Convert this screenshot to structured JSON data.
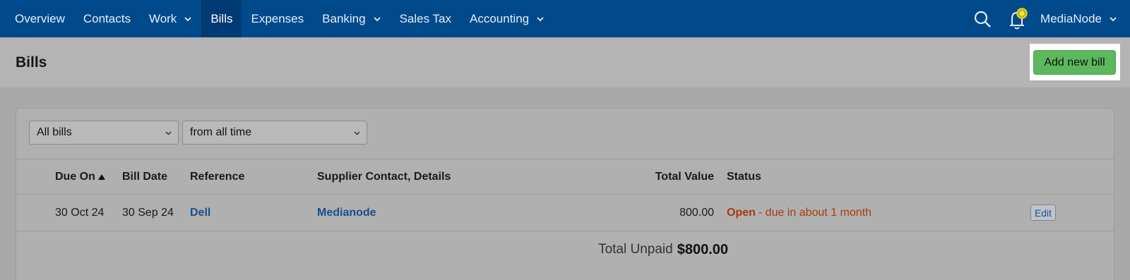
{
  "nav": {
    "items": [
      {
        "label": "Overview",
        "dropdown": false,
        "active": false
      },
      {
        "label": "Contacts",
        "dropdown": false,
        "active": false
      },
      {
        "label": "Work",
        "dropdown": true,
        "active": false
      },
      {
        "label": "Bills",
        "dropdown": false,
        "active": true
      },
      {
        "label": "Expenses",
        "dropdown": false,
        "active": false
      },
      {
        "label": "Banking",
        "dropdown": true,
        "active": false
      },
      {
        "label": "Sales Tax",
        "dropdown": false,
        "active": false
      },
      {
        "label": "Accounting",
        "dropdown": true,
        "active": false
      }
    ],
    "user_label": "MediaNode"
  },
  "page": {
    "title": "Bills",
    "add_button_label": "Add new bill"
  },
  "filters": {
    "bill_filter": "All bills",
    "time_filter": "from all time"
  },
  "table": {
    "headers": {
      "due_on": "Due On",
      "bill_date": "Bill Date",
      "reference": "Reference",
      "supplier": "Supplier Contact, Details",
      "total_value": "Total Value",
      "status": "Status"
    },
    "rows": [
      {
        "due_on": "30 Oct 24",
        "bill_date": "30 Sep 24",
        "reference": "Dell",
        "supplier": "Medianode",
        "total_value": "800.00",
        "status": "Open",
        "status_detail": "- due in about 1 month",
        "edit_label": "Edit"
      }
    ],
    "footer": {
      "label": "Total Unpaid",
      "amount": "$800.00"
    }
  },
  "colors": {
    "nav_bg": "#004a8c",
    "accent_green": "#5cb85c",
    "link_blue": "#1a4f8f",
    "status_open": "#a83b0d"
  }
}
